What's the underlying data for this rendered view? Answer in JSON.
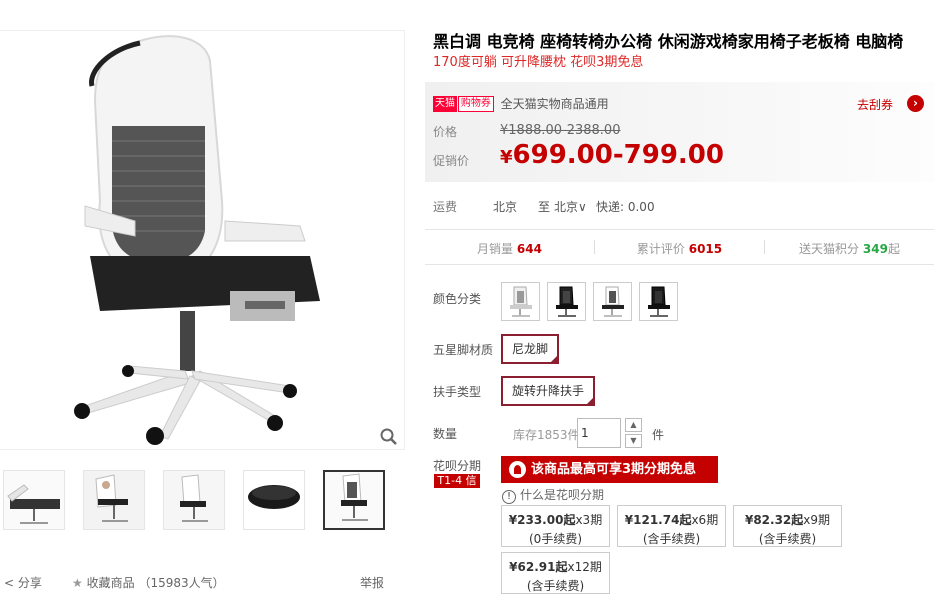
{
  "product": {
    "title": "黑白调 电竞椅 座椅转椅办公椅 休闲游戏椅家用椅子老板椅 电脑椅",
    "subtitle": "170度可躺 可升降腰枕 花呗3期免息"
  },
  "promo": {
    "tmall_tag": "天猫",
    "coupon_tag": "购物券",
    "text": "全天猫实物商品通用",
    "link": "去刮券"
  },
  "price": {
    "orig_label": "价格",
    "orig_value": "¥1888.00-2388.00",
    "sale_label": "促销价",
    "currency": "¥",
    "sale_value": "699.00-799.00"
  },
  "shipping": {
    "label": "运费",
    "from": "北京",
    "to": "至",
    "city": "北京",
    "cost": "快递: 0.00"
  },
  "stats": [
    {
      "label": "月销量",
      "value": "644",
      "suffix": ""
    },
    {
      "label": "累计评价",
      "value": "6015",
      "suffix": ""
    },
    {
      "label": "送天猫积分",
      "value": "349",
      "suffix": "起"
    }
  ],
  "options": {
    "color_label": "颜色分类",
    "base_label": "五星脚材质",
    "base_value": "尼龙脚",
    "armrest_label": "扶手类型",
    "armrest_value": "旋转升降扶手",
    "qty_label": "数量",
    "stock": "库存1853件",
    "qty_value": "1",
    "unit": "件"
  },
  "huabei": {
    "label": "花呗分期",
    "tag": "T1-4 信",
    "banner": "该商品最高可享3期分期免息",
    "what": "什么是花呗分期",
    "plans": [
      {
        "amount": "¥233.00起",
        "term": "x3期",
        "fee": "(0手续费)"
      },
      {
        "amount": "¥121.74起",
        "term": "x6期",
        "fee": "(含手续费)"
      },
      {
        "amount": "¥82.32起",
        "term": "x9期",
        "fee": "(含手续费)"
      },
      {
        "amount": "¥62.91起",
        "term": "x12期",
        "fee": "(含手续费)"
      }
    ]
  },
  "social": {
    "share": "分享",
    "favorite": "收藏商品",
    "popularity": "（15983人气）",
    "report": "举报"
  },
  "colors": {
    "accent": "#c40000",
    "sku_border": "#8c1f2f",
    "tmall_red": "#ff0036",
    "points_green": "#28a745"
  }
}
